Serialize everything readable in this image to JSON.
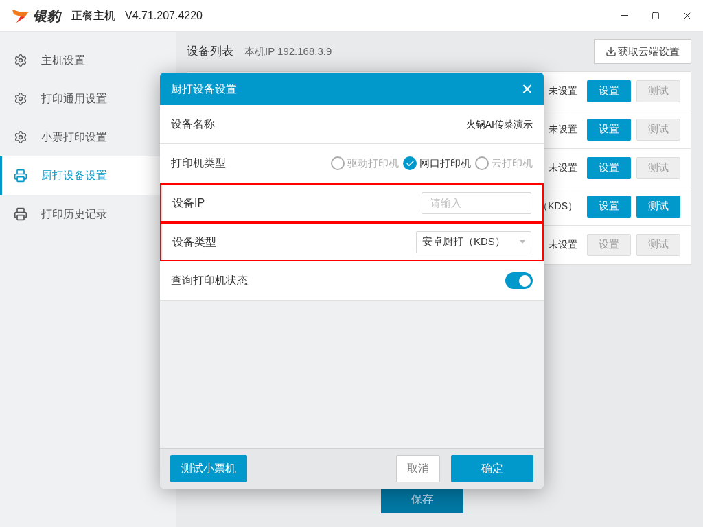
{
  "titlebar": {
    "logo_text": "银豹",
    "app_name": "正餐主机",
    "version": "V4.71.207.4220"
  },
  "sidebar": {
    "items": [
      {
        "label": "主机设置",
        "selected": false
      },
      {
        "label": "打印通用设置",
        "selected": false
      },
      {
        "label": "小票打印设置",
        "selected": false
      },
      {
        "label": "厨打设备设置",
        "selected": true
      },
      {
        "label": "打印历史记录",
        "selected": false
      }
    ]
  },
  "main": {
    "title": "设备列表",
    "local_ip": "本机IP 192.168.3.9",
    "fetch_button": "获取云端设置",
    "rows": [
      {
        "status": "未设置",
        "setup_button": "设置",
        "setup_disabled": false,
        "test_button": "测试",
        "test_disabled": true
      },
      {
        "status": "未设置",
        "setup_button": "设置",
        "setup_disabled": false,
        "test_button": "测试",
        "test_disabled": true
      },
      {
        "status": "未设置",
        "setup_button": "设置",
        "setup_disabled": false,
        "test_button": "测试",
        "test_disabled": true
      },
      {
        "status": "（KDS）",
        "setup_button": "设置",
        "setup_disabled": false,
        "test_button": "测试",
        "test_disabled": false
      },
      {
        "status": "未设置",
        "setup_button": "设置",
        "setup_disabled": true,
        "test_button": "测试",
        "test_disabled": true
      }
    ],
    "save_button": "保存"
  },
  "dialog": {
    "title": "厨打设备设置",
    "close": "×",
    "rows": [
      {
        "kind": "text",
        "label": "设备名称",
        "value": "火锅AI传菜演示",
        "highlighted": false
      },
      {
        "kind": "radio",
        "label": "打印机类型",
        "highlighted": false,
        "options": [
          {
            "label": "驱动打印机",
            "selected": false
          },
          {
            "label": "网口打印机",
            "selected": true
          },
          {
            "label": "云打印机",
            "selected": false
          }
        ]
      },
      {
        "kind": "input",
        "label": "设备IP",
        "placeholder": "请输入",
        "highlighted": true
      },
      {
        "kind": "select",
        "label": "设备类型",
        "value": "安卓厨打（KDS）",
        "highlighted": true
      },
      {
        "kind": "toggle",
        "label": "查询打印机状态",
        "on": true,
        "highlighted": false
      }
    ],
    "test_button": "测试小票机",
    "cancel_button": "取消",
    "ok_button": "确定"
  }
}
